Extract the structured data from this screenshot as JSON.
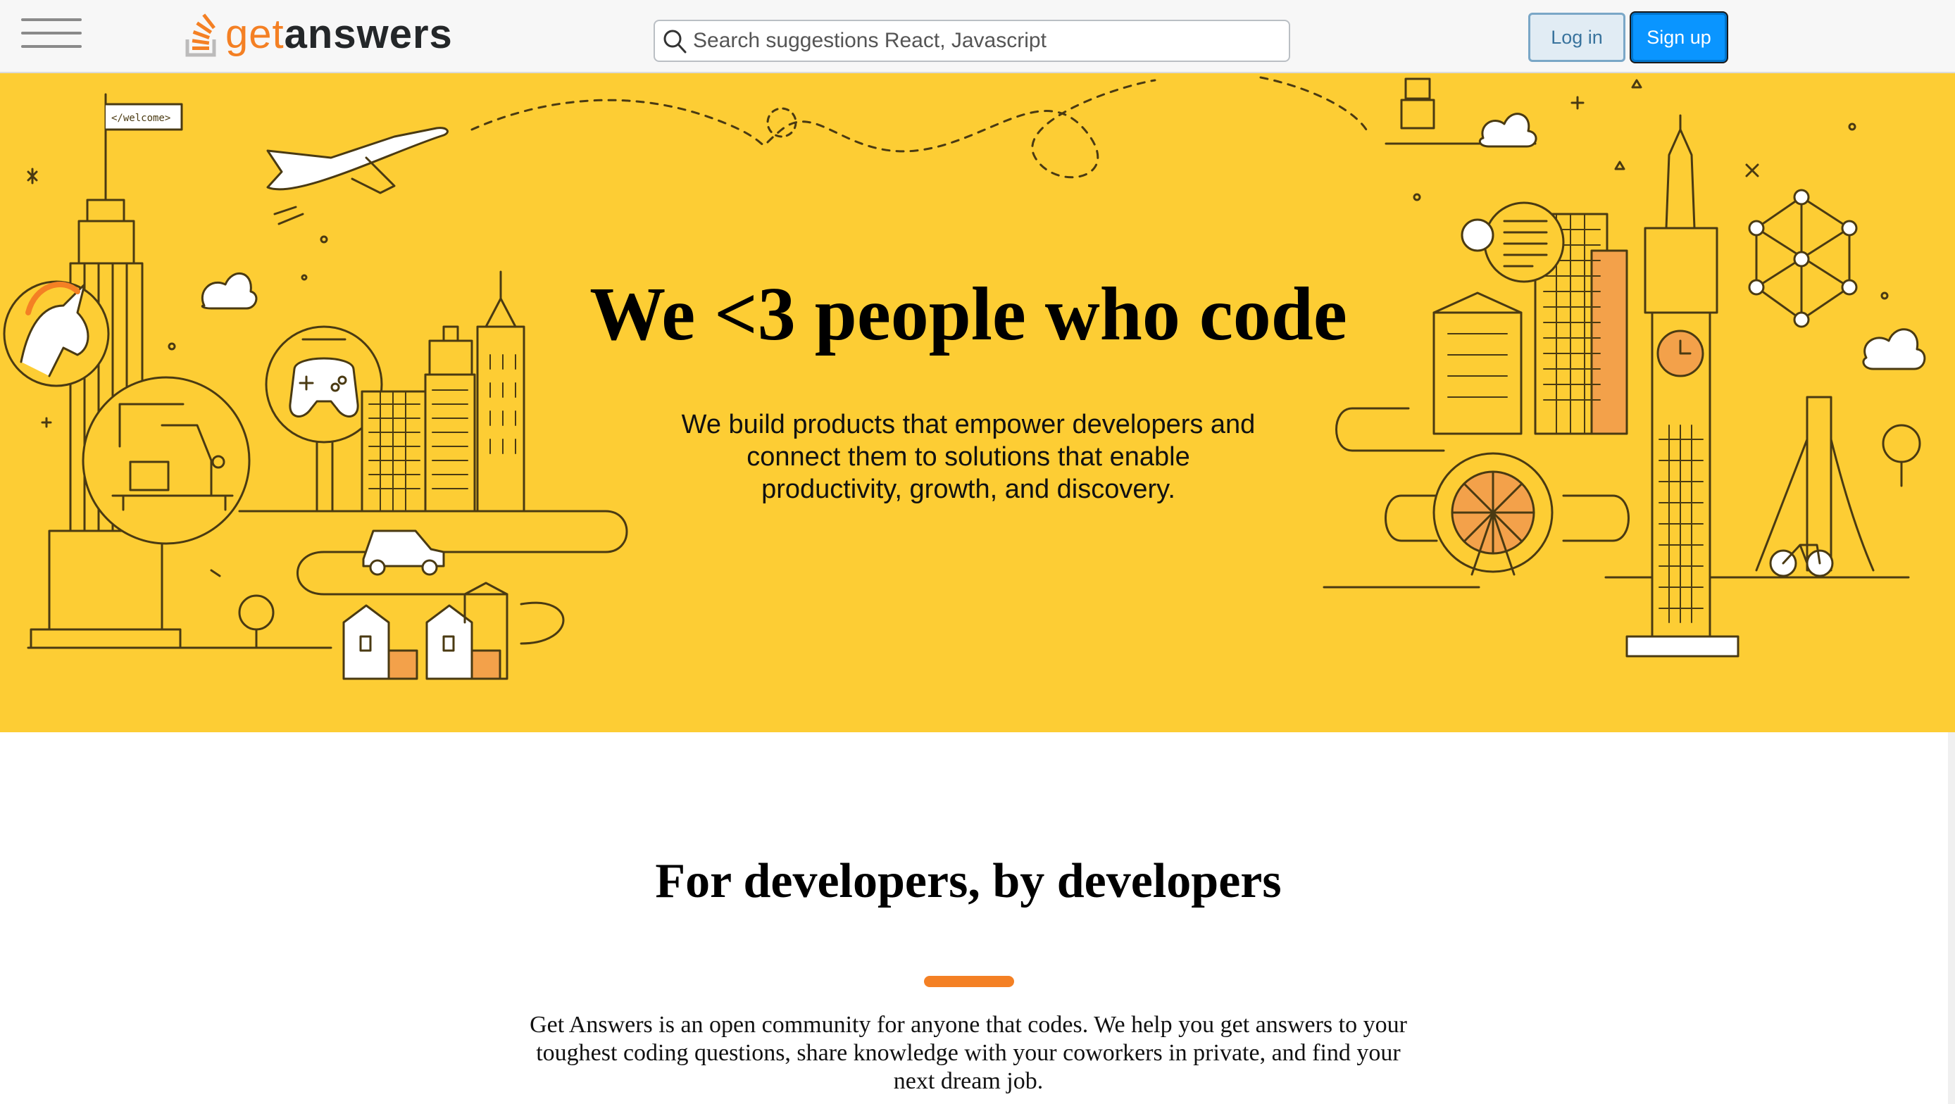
{
  "header": {
    "logo": {
      "part1": "get",
      "part2": "answers"
    },
    "search": {
      "placeholder": "Search suggestions React, Javascript",
      "value": ""
    },
    "login_label": "Log in",
    "signup_label": "Sign up"
  },
  "hero": {
    "title": "We <3 people who code",
    "subtitle": "We build products that empower developers and connect them to solutions that enable productivity, growth, and discovery.",
    "sign_text": "</welcome>"
  },
  "about": {
    "title": "For developers, by developers",
    "body": "Get Answers is an open community for anyone that codes. We help you get answers to your toughest coding questions, share knowledge with your coworkers in private, and find your next dream job."
  },
  "colors": {
    "hero_background": "#fdcd34",
    "accent": "#f48024",
    "signup": "#0a95ff",
    "login": "#e1ecf4"
  },
  "icons": [
    "hamburger-menu-icon",
    "stack-logo-icon",
    "search-icon"
  ]
}
